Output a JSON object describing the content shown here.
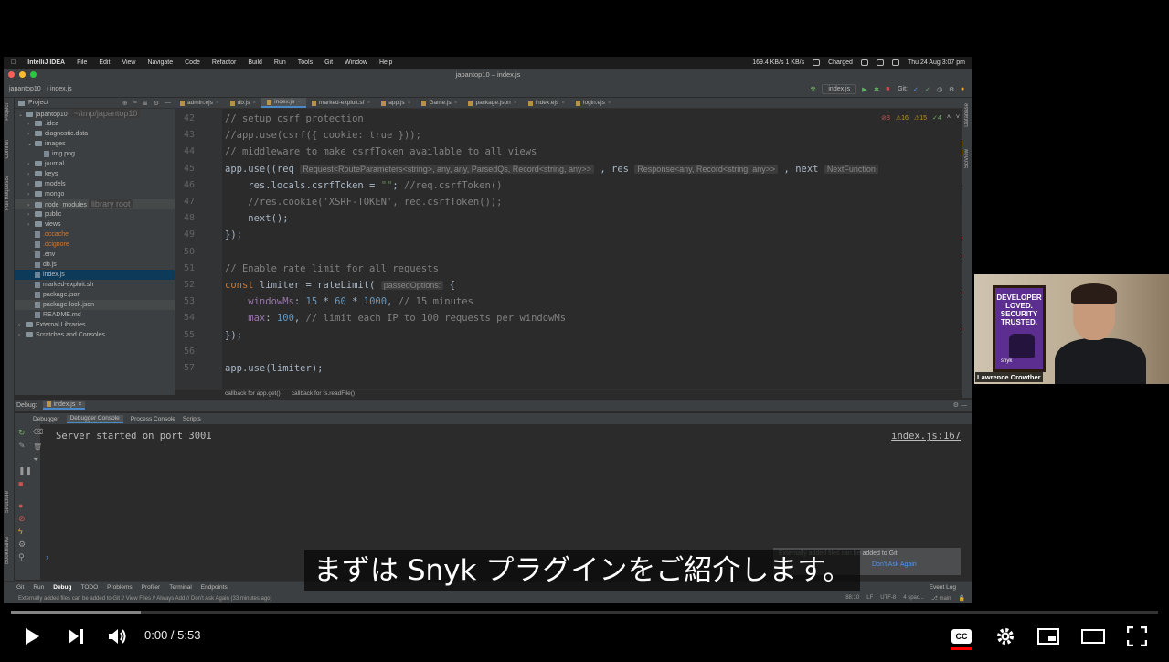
{
  "menubar": {
    "app": "IntelliJ IDEA",
    "items": [
      "File",
      "Edit",
      "View",
      "Navigate",
      "Code",
      "Refactor",
      "Build",
      "Run",
      "Tools",
      "Git",
      "Window",
      "Help"
    ],
    "net_up": "169.4 KB/s",
    "net_down": "1 KB/s",
    "battery": "Charged",
    "datetime": "Thu 24 Aug  3:07 pm"
  },
  "window": {
    "title": "japantop10 – index.js"
  },
  "navbar": {
    "project": "japantop10",
    "file": "index.js",
    "run_config": "index.js",
    "git_label": "Git:"
  },
  "project_panel": {
    "title": "Project",
    "root": "japantop10",
    "root_path": "~/tmp/japantop10",
    "items": [
      {
        "name": ".idea",
        "kind": "folder",
        "arrow": "›",
        "indent": 1
      },
      {
        "name": "diagnostic.data",
        "kind": "folder",
        "arrow": "›",
        "indent": 1
      },
      {
        "name": "images",
        "kind": "folder",
        "arrow": "⌄",
        "indent": 1
      },
      {
        "name": "img.png",
        "kind": "file",
        "arrow": "",
        "indent": 2
      },
      {
        "name": "journal",
        "kind": "folder",
        "arrow": "›",
        "indent": 1
      },
      {
        "name": "keys",
        "kind": "folder",
        "arrow": "›",
        "indent": 1
      },
      {
        "name": "models",
        "kind": "folder",
        "arrow": "›",
        "indent": 1
      },
      {
        "name": "mongo",
        "kind": "folder",
        "arrow": "›",
        "indent": 1
      },
      {
        "name": "node_modules",
        "kind": "folder",
        "arrow": "›",
        "indent": 1,
        "hint": "library root",
        "style": "dim"
      },
      {
        "name": "public",
        "kind": "folder",
        "arrow": "›",
        "indent": 1
      },
      {
        "name": "views",
        "kind": "folder",
        "arrow": "›",
        "indent": 1
      },
      {
        "name": ".dccache",
        "kind": "file",
        "arrow": "",
        "indent": 1,
        "style": "red"
      },
      {
        "name": ".dcignore",
        "kind": "file",
        "arrow": "",
        "indent": 1,
        "style": "red"
      },
      {
        "name": ".env",
        "kind": "file",
        "arrow": "",
        "indent": 1
      },
      {
        "name": "db.js",
        "kind": "file",
        "arrow": "",
        "indent": 1
      },
      {
        "name": "index.js",
        "kind": "file",
        "arrow": "",
        "indent": 1,
        "style": "sel"
      },
      {
        "name": "marked-exploit.sh",
        "kind": "file",
        "arrow": "",
        "indent": 1
      },
      {
        "name": "package.json",
        "kind": "file",
        "arrow": "",
        "indent": 1
      },
      {
        "name": "package-lock.json",
        "kind": "file",
        "arrow": "",
        "indent": 1,
        "style": "dim"
      },
      {
        "name": "README.md",
        "kind": "file",
        "arrow": "",
        "indent": 1
      },
      {
        "name": "External Libraries",
        "kind": "folder",
        "arrow": "›",
        "indent": 0
      },
      {
        "name": "Scratches and Consoles",
        "kind": "folder",
        "arrow": "›",
        "indent": 0
      }
    ]
  },
  "tabs": [
    "admin.ejs",
    "db.js",
    "index.js",
    "marked-exploit.sf",
    "app.js",
    "Game.js",
    "package.json",
    "index.ejs",
    "login.ejs"
  ],
  "inspection": {
    "errors": "3",
    "warnings": "16",
    "weak": "15",
    "typos": "4"
  },
  "code": {
    "lines": [
      {
        "n": "42",
        "segs": [
          {
            "c": "c-cm",
            "t": "// setup csrf protection"
          }
        ]
      },
      {
        "n": "43",
        "segs": [
          {
            "c": "c-cm",
            "t": "//app.use(csrf({ cookie: true }));"
          }
        ]
      },
      {
        "n": "44",
        "segs": [
          {
            "c": "c-cm",
            "t": "// middleware to make csrfToken available to all views"
          }
        ]
      },
      {
        "n": "45",
        "segs": [
          {
            "c": "",
            "t": "app.use((req "
          },
          {
            "c": "hint",
            "t": "Request<RouteParameters<string>, any, any, ParsedQs, Record<string, any>>"
          },
          {
            "c": "",
            "t": " , res "
          },
          {
            "c": "hint",
            "t": "Response<any, Record<string, any>>"
          },
          {
            "c": "",
            "t": " , next "
          },
          {
            "c": "hint",
            "t": "NextFunction"
          }
        ]
      },
      {
        "n": "46",
        "segs": [
          {
            "c": "",
            "t": "    res.locals.csrfToken = "
          },
          {
            "c": "c-str",
            "t": "\"\""
          },
          {
            "c": "",
            "t": "; "
          },
          {
            "c": "c-cm",
            "t": "//req.csrfToken()"
          }
        ]
      },
      {
        "n": "47",
        "segs": [
          {
            "c": "c-cm",
            "t": "    //res.cookie('XSRF-TOKEN', req.csrfToken());"
          }
        ]
      },
      {
        "n": "48",
        "segs": [
          {
            "c": "",
            "t": "    next();"
          }
        ]
      },
      {
        "n": "49",
        "segs": [
          {
            "c": "",
            "t": "});"
          }
        ]
      },
      {
        "n": "50",
        "segs": []
      },
      {
        "n": "51",
        "segs": [
          {
            "c": "c-cm",
            "t": "// Enable rate limit for all requests"
          }
        ]
      },
      {
        "n": "52",
        "segs": [
          {
            "c": "c-kw",
            "t": "const "
          },
          {
            "c": "",
            "t": "limiter = rateLimit( "
          },
          {
            "c": "hint",
            "t": "passedOptions:"
          },
          {
            "c": "",
            "t": " {"
          }
        ]
      },
      {
        "n": "53",
        "segs": [
          {
            "c": "c-p",
            "t": "    windowMs"
          },
          {
            "c": "",
            "t": ": "
          },
          {
            "c": "c-num",
            "t": "15"
          },
          {
            "c": "",
            "t": " * "
          },
          {
            "c": "c-num",
            "t": "60"
          },
          {
            "c": "",
            "t": " * "
          },
          {
            "c": "c-num",
            "t": "1000"
          },
          {
            "c": "",
            "t": ", "
          },
          {
            "c": "c-cm",
            "t": "// 15 minutes"
          }
        ]
      },
      {
        "n": "54",
        "segs": [
          {
            "c": "c-p",
            "t": "    max"
          },
          {
            "c": "",
            "t": ": "
          },
          {
            "c": "c-num",
            "t": "100"
          },
          {
            "c": "",
            "t": ", "
          },
          {
            "c": "c-cm",
            "t": "// limit each IP to 100 requests per windowMs"
          }
        ]
      },
      {
        "n": "55",
        "segs": [
          {
            "c": "",
            "t": "});"
          }
        ]
      },
      {
        "n": "56",
        "segs": []
      },
      {
        "n": "57",
        "segs": [
          {
            "c": "",
            "t": "app.use(limiter);"
          }
        ]
      }
    ]
  },
  "editor_breadcrumb": [
    "callback for app.get()",
    "callback for fs.readFile()"
  ],
  "debug": {
    "label": "Debug:",
    "session": "index.js",
    "tabs": [
      "Debugger",
      "Debugger Console",
      "Process Console",
      "Scripts"
    ],
    "console_line": "Server started on port 3001",
    "console_link": "index.js:167"
  },
  "notification": {
    "text": "Externally added files can be added to Git",
    "link": "Don't Ask Again"
  },
  "bottom_tools": [
    "Git",
    "Run",
    "Debug",
    "TODO",
    "Problems",
    "Profiler",
    "Terminal",
    "Endpoints"
  ],
  "event_log": "Event Log",
  "status": {
    "message": "Externally added files can be added to Git // View Files // Always Add // Don't Ask Again (33 minutes ago)",
    "position": "88:10",
    "line_sep": "LF",
    "encoding": "UTF-8",
    "indent": "4 spac...",
    "branch": "main"
  },
  "webcam": {
    "name": "Lawrence Crowther",
    "poster_text": "DEVELOPER LOVED. SECURITY TRUSTED.",
    "poster_brand": "snyk"
  },
  "subtitle": "まずは Snyk プラグインをご紹介します。",
  "player": {
    "current": "0:00",
    "separator": " / ",
    "duration": "5:53",
    "progress": 0.0,
    "buffered": 0.113
  }
}
